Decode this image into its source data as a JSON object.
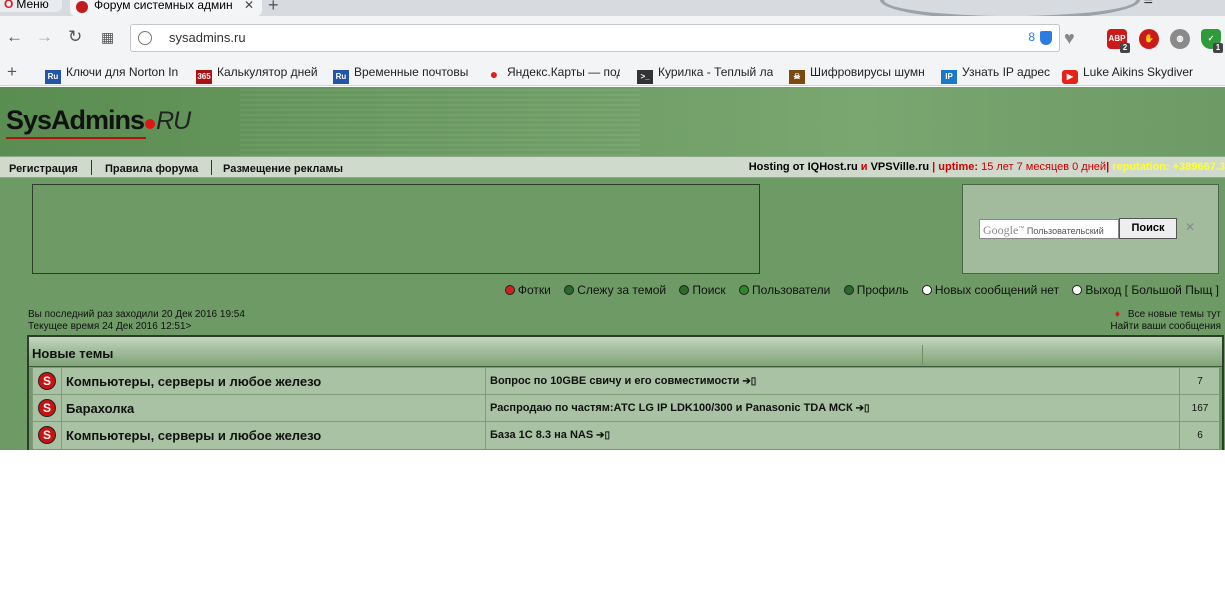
{
  "browser": {
    "menu_label": "Меню",
    "tab_title": "Форум системных админ",
    "tab_close": "✕",
    "new_tab": "+",
    "url": "sysadmins.ru",
    "blocked_count": "8",
    "ext_abp_badge": "2",
    "ext_last_badge": "1"
  },
  "bookmarks": [
    {
      "label": "Ключи для Norton In",
      "icon": "Ru",
      "color": "#2255aa"
    },
    {
      "label": "Калькулятор дней",
      "icon": "365",
      "color": "#a11"
    },
    {
      "label": "Временные почтовы",
      "icon": "Ru",
      "color": "#2255aa"
    },
    {
      "label": "Яндекс.Карты — под",
      "icon": "map-pin-icon",
      "color": "#e02020"
    },
    {
      "label": "Курилка - Теплый ла",
      "icon": "terminal-icon",
      "color": "#333"
    },
    {
      "label": "Шифровирусы шумн",
      "icon": "skull-icon",
      "color": "#7a4a10"
    },
    {
      "label": "Узнать IP адрес",
      "icon": "IP",
      "color": "#1a77c9"
    },
    {
      "label": "Luke Aikins Skydiver",
      "icon": "youtube-icon",
      "color": "#e62117"
    }
  ],
  "site": {
    "logo_text": "SysAdmins",
    "logo_suffix": "RU"
  },
  "topnav": {
    "register": "Регистрация",
    "rules": "Правила форума",
    "ads": "Размещение рекламы"
  },
  "hosting": {
    "prefix": "Hosting от IQHost.ru",
    "and": " и ",
    "site2": "VPSVille.ru",
    "sep1": " | ",
    "uptime_label": "uptime:",
    "uptime_value": " 15 лет 7 месяцев 0 дней",
    "sep2": "|",
    "reputation": " reputation: +389667.3"
  },
  "search": {
    "google_label": "Google",
    "placeholder": "Пользовательский",
    "button": "Поиск",
    "clear": "✕"
  },
  "iconnav": [
    {
      "label": "Фотки",
      "color": "#cc2222"
    },
    {
      "label": "Слежу за темой",
      "color": "#2a6a2a"
    },
    {
      "label": "Поиск",
      "color": "#2a6a2a"
    },
    {
      "label": "Пользователи",
      "color": "#2a8a2a"
    },
    {
      "label": "Профиль",
      "color": "#2a6a2a"
    },
    {
      "label": "Новых сообщений нет",
      "color": "#ffffff"
    },
    {
      "label": "Выход [ Большой Пыщ ]",
      "color": "#ffffff"
    }
  ],
  "lastvisit": {
    "line1": "Вы последний раз заходили 20 Дек 2016 19:54",
    "line2": "Текущее время 24 Дек 2016 12:51>"
  },
  "newtopics": {
    "line1": "Все новые темы тут",
    "line2": "Найти ваши сообщения"
  },
  "table": {
    "title": "Новые темы",
    "rows": [
      {
        "forum": "Компьютеры, серверы и любое железо",
        "topic": "Вопрос по 10GBE свичу и его совместимости",
        "count": "7"
      },
      {
        "forum": "Барахолка",
        "topic": "Распродаю по частям:АТС LG IP LDK100/300 и Panasonic TDA МСК",
        "count": "167"
      },
      {
        "forum": "Компьютеры, серверы и любое железо",
        "topic": "База 1С 8.3 на NAS",
        "count": "6"
      }
    ]
  }
}
